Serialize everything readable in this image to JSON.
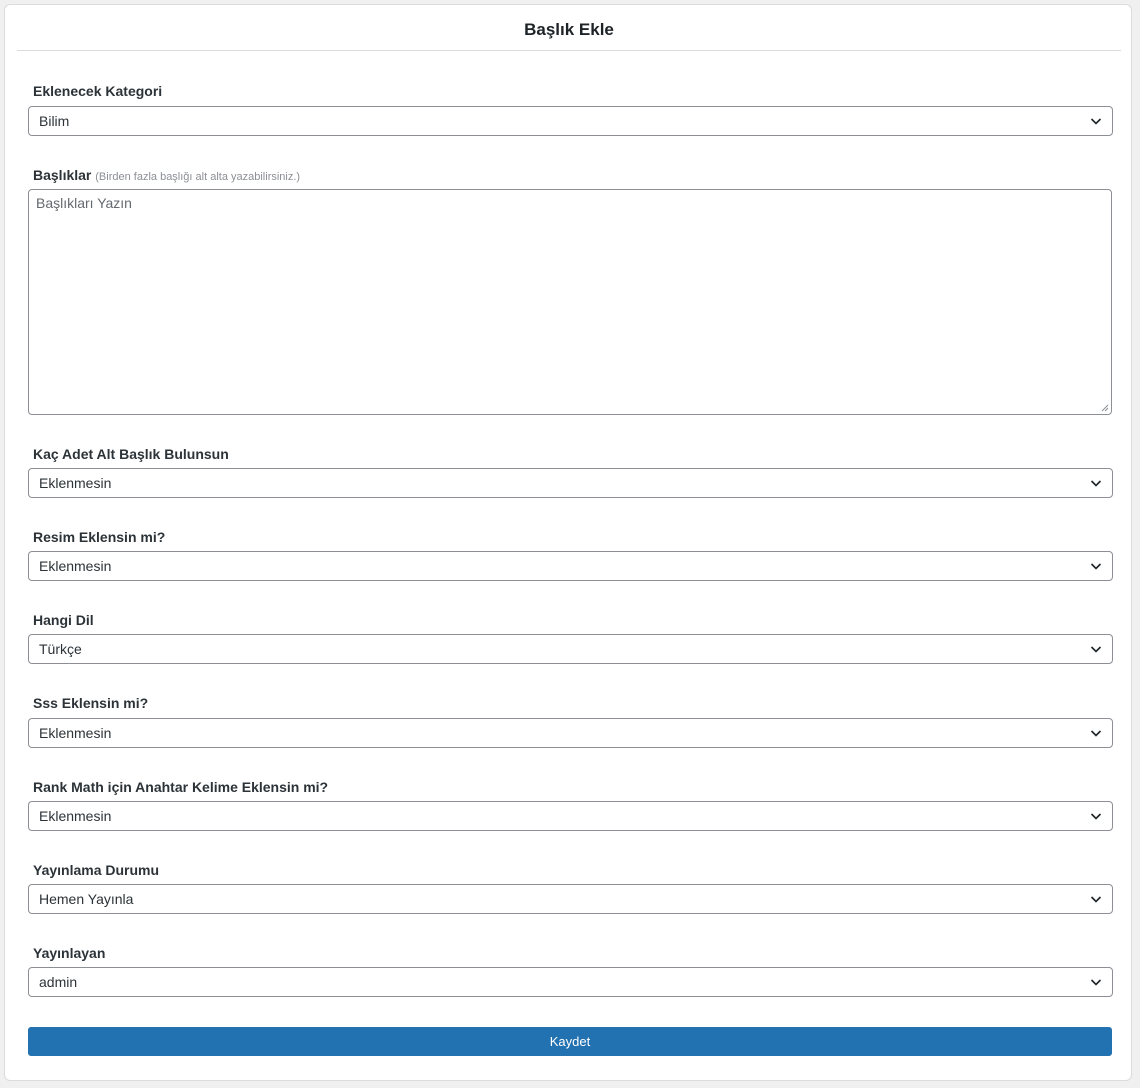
{
  "header": {
    "title": "Başlık Ekle"
  },
  "form": {
    "category": {
      "label": "Eklenecek Kategori",
      "value": "Bilim"
    },
    "titles": {
      "label": "Başlıklar",
      "hint": "(Birden fazla başlığı alt alta yazabilirsiniz.)",
      "placeholder": "Başlıkları Yazın",
      "value": ""
    },
    "subheading_count": {
      "label": "Kaç Adet Alt Başlık Bulunsun",
      "value": "Eklenmesin"
    },
    "add_image": {
      "label": "Resim Eklensin mi?",
      "value": "Eklenmesin"
    },
    "language": {
      "label": "Hangi Dil",
      "value": "Türkçe"
    },
    "faq": {
      "label": "Sss Eklensin mi?",
      "value": "Eklenmesin"
    },
    "rank_math_keyword": {
      "label": "Rank Math için Anahtar Kelime Eklensin mi?",
      "value": "Eklenmesin"
    },
    "publish_status": {
      "label": "Yayınlama Durumu",
      "value": "Hemen Yayınla"
    },
    "publisher": {
      "label": "Yayınlayan",
      "value": "admin"
    }
  },
  "actions": {
    "save_label": "Kaydet"
  },
  "icons": {
    "select_arrow": "chevron-down-icon",
    "textarea_resize": "resize-grip-icon"
  },
  "colors": {
    "primary_button": "#2271b1",
    "border": "#8c8f94"
  }
}
